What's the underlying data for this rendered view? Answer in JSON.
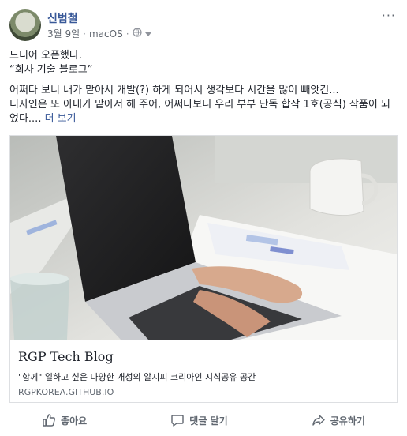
{
  "post": {
    "author": "신범철",
    "date": "3월 9일",
    "via": "macOS",
    "privacy_icon": "globe-icon",
    "line1": "드디어 오픈했다.",
    "line2": "“회사 기술 블로그”",
    "line3": "어쩌다 보니 내가 맡아서 개발(?) 하게 되어서 생각보다 시간을 많이 빼앗긴...",
    "line4": "디자인은 또 아내가 맡아서 해 주어, 어쩌다보니 우리 부부 단독 합작 1호(공식) 작품이 되",
    "line5_prefix": "었다....",
    "see_more": "더 보기"
  },
  "link_preview": {
    "title": "RGP Tech Blog",
    "description": "\"함께\" 일하고 싶은 다양한 개성의 알지피 코리아인 지식공유 공간",
    "domain": "RGPKOREA.GITHUB.IO"
  },
  "actions": {
    "like": "좋아요",
    "comment": "댓글 달기",
    "share": "공유하기"
  },
  "colors": {
    "link_blue": "#385898",
    "secondary_text": "#606770"
  }
}
